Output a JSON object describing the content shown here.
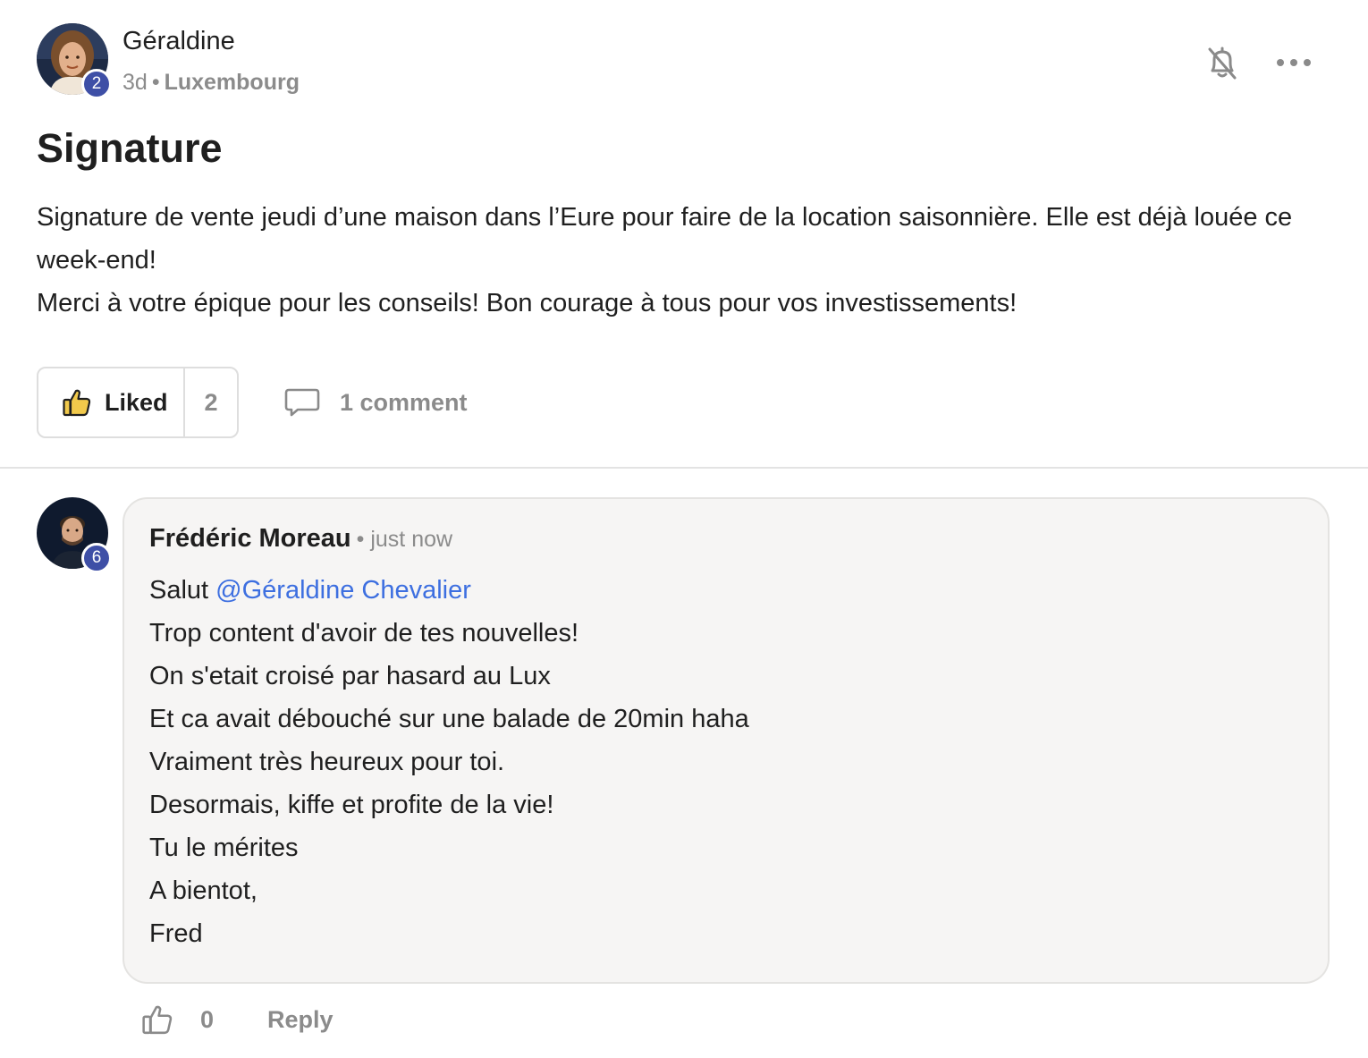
{
  "post": {
    "author": {
      "name": "Géraldine",
      "level": "2",
      "avatar_icon": "woman-avatar"
    },
    "meta": {
      "time": "3d",
      "separator": "•",
      "location": "Luxembourg"
    },
    "header_actions": {
      "notifications_icon": "bell-off-icon",
      "more_icon": "more-horizontal-icon"
    },
    "title": "Signature",
    "body": {
      "paragraph_1": "Signature de vente jeudi d’une maison dans l’Eure pour faire de la location saisonnière. Elle est déjà louée ce week-end!",
      "paragraph_2": "Merci à votre épique pour les conseils! Bon courage à tous pour vos investissements!"
    },
    "actions": {
      "like_label": "Liked",
      "like_count": "2",
      "comment_label": "1 comment"
    }
  },
  "comment": {
    "author": {
      "name": "Frédéric Moreau",
      "level": "6",
      "avatar_icon": "man-avatar"
    },
    "time": "• just now",
    "greeting": "Salut",
    "mention": "@Géraldine Chevalier",
    "lines": [
      "Trop content d'avoir de tes nouvelles!",
      "On s'etait croisé par hasard au Lux",
      "Et ca avait débouché sur une balade de 20min haha",
      "Vraiment très heureux pour toi.",
      "Desormais, kiffe et profite de la vie!",
      "Tu le mérites",
      "A bientot,",
      "Fred"
    ],
    "actions": {
      "like_count": "0",
      "reply_label": "Reply"
    }
  },
  "colors": {
    "badge": "#3e4fa6",
    "mention": "#3d6fe0",
    "muted_text": "#8b8b8b",
    "like_thumb_fill": "#f1c94b",
    "comment_bg": "#f6f5f4"
  }
}
